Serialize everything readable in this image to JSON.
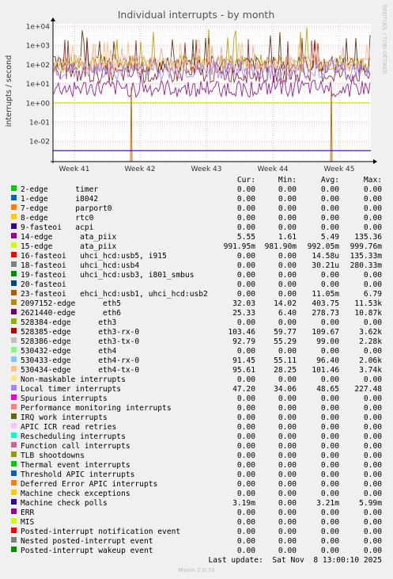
{
  "chart_data": {
    "type": "line",
    "title": "Individual interrupts - by month",
    "ylabel": "interrupts / second",
    "y_scale": "log",
    "ylim": [
      0.003,
      20000
    ],
    "yticks": [
      "1e+04",
      "1e+03",
      "1e+02",
      "1e+01",
      "1e+00",
      "1e-01",
      "1e-02"
    ],
    "xticks": [
      "Week 41",
      "Week 42",
      "Week 43",
      "Week 44",
      "Week 45"
    ],
    "watermark": "RRDTOOL / TOBI OETIKER",
    "grid": true,
    "series_levels": [
      {
        "name": "2097152-edge eth5",
        "color": "#b39b00",
        "base": 130,
        "spikes": [
          3000,
          9000
        ]
      },
      {
        "name": "2621440-edge eth6",
        "color": "#4c2a0e",
        "base": 100,
        "spikes": [
          2500,
          6500
        ]
      },
      {
        "name": "528385-edge eth3-rx-0",
        "color": "#8a1c1c",
        "base": 30,
        "spikes": [
          2000,
          2800
        ]
      },
      {
        "name": "530432-edge eth4",
        "color": "#f1a3a0",
        "base": 110,
        "spikes": [
          1200
        ]
      },
      {
        "name": "530434-edge eth4-tx-0",
        "color": "#ffc080",
        "base": 100,
        "spikes": [
          1800
        ]
      },
      {
        "name": "Local timer interrupts",
        "color": "#a080ff",
        "base": 45,
        "spikes": [
          200
        ]
      },
      {
        "name": "14-edge ata_piix",
        "color": "#8a0e8a",
        "base": 5.5,
        "spikes": [
          30
        ]
      },
      {
        "name": "15-edge ata_piix",
        "color": "#ccdd00",
        "base": 0.99,
        "spikes": []
      },
      {
        "name": "23-fasteoi ehci_hcd:usb1, uhci_hcd:usb2",
        "color": "#b86e10",
        "base": 0,
        "spikes": [
          6.79
        ]
      }
    ]
  },
  "legend": {
    "headers": {
      "cur": "Cur:",
      "min": "Min:",
      "avg": "Avg:",
      "max": "Max:"
    },
    "rows": [
      {
        "name": "2-edge      timer",
        "color": "#00cc00",
        "cur": "0.00",
        "min": "0.00",
        "avg": "0.00",
        "max": "0.00"
      },
      {
        "name": "1-edge      i8042",
        "color": "#0066b3",
        "cur": "0.00",
        "min": "0.00",
        "avg": "0.00",
        "max": "0.00"
      },
      {
        "name": "7-edge      parport0",
        "color": "#ff8000",
        "cur": "0.00",
        "min": "0.00",
        "avg": "0.00",
        "max": "0.00"
      },
      {
        "name": "8-edge      rtc0",
        "color": "#ffcc00",
        "cur": "0.00",
        "min": "0.00",
        "avg": "0.00",
        "max": "0.00"
      },
      {
        "name": "9-fasteoi   acpi",
        "color": "#330099",
        "cur": "0.00",
        "min": "0.00",
        "avg": "0.00",
        "max": "0.00"
      },
      {
        "name": "14-edge      ata_piix",
        "color": "#990099",
        "cur": "5.55",
        "min": "1.61",
        "avg": "5.49",
        "max": "135.36"
      },
      {
        "name": "15-edge      ata_piix",
        "color": "#ccff00",
        "cur": "991.95m",
        "min": "981.90m",
        "avg": "992.05m",
        "max": "999.76m"
      },
      {
        "name": "16-fasteoi   uhci_hcd:usb5, i915",
        "color": "#ff0000",
        "cur": "0.00",
        "min": "0.00",
        "avg": "14.58u",
        "max": "135.33m"
      },
      {
        "name": "18-fasteoi   uhci_hcd:usb4",
        "color": "#808080",
        "cur": "0.00",
        "min": "0.00",
        "avg": "30.21u",
        "max": "280.33m"
      },
      {
        "name": "19-fasteoi   uhci_hcd:usb3, i801_smbus",
        "color": "#008f00",
        "cur": "0.00",
        "min": "0.00",
        "avg": "0.00",
        "max": "0.00"
      },
      {
        "name": "20-fasteoi",
        "color": "#00487d",
        "cur": "0.00",
        "min": "0.00",
        "avg": "0.00",
        "max": "0.00"
      },
      {
        "name": "23-fasteoi   ehci_hcd:usb1, uhci_hcd:usb2",
        "color": "#b35a00",
        "cur": "0.00",
        "min": "0.00",
        "avg": "11.05m",
        "max": "6.79"
      },
      {
        "name": "2097152-edge      eth5",
        "color": "#b38f00",
        "cur": "32.03",
        "min": "14.02",
        "avg": "403.75",
        "max": "11.53k"
      },
      {
        "name": "2621440-edge      eth6",
        "color": "#6b006b",
        "cur": "25.33",
        "min": "6.40",
        "avg": "278.73",
        "max": "10.87k"
      },
      {
        "name": "528384-edge      eth3",
        "color": "#8fb300",
        "cur": "0.00",
        "min": "0.00",
        "avg": "0.00",
        "max": "0.00"
      },
      {
        "name": "528385-edge      eth3-rx-0",
        "color": "#b30000",
        "cur": "103.46",
        "min": "59.77",
        "avg": "109.67",
        "max": "3.62k"
      },
      {
        "name": "528386-edge      eth3-tx-0",
        "color": "#bebebe",
        "cur": "92.79",
        "min": "55.29",
        "avg": "99.00",
        "max": "2.28k"
      },
      {
        "name": "530432-edge      eth4",
        "color": "#80ff80",
        "cur": "0.00",
        "min": "0.00",
        "avg": "0.00",
        "max": "0.00"
      },
      {
        "name": "530433-edge      eth4-rx-0",
        "color": "#80c9ff",
        "cur": "91.45",
        "min": "55.11",
        "avg": "96.40",
        "max": "2.06k"
      },
      {
        "name": "530434-edge      eth4-tx-0",
        "color": "#ffc080",
        "cur": "95.61",
        "min": "28.25",
        "avg": "101.46",
        "max": "3.74k"
      },
      {
        "name": "Non-maskable interrupts",
        "color": "#ffe680",
        "cur": "0.00",
        "min": "0.00",
        "avg": "0.00",
        "max": "0.00"
      },
      {
        "name": "Local timer interrupts",
        "color": "#aa80ff",
        "cur": "47.20",
        "min": "34.06",
        "avg": "48.65",
        "max": "227.48"
      },
      {
        "name": "Spurious interrupts",
        "color": "#ee00cc",
        "cur": "0.00",
        "min": "0.00",
        "avg": "0.00",
        "max": "0.00"
      },
      {
        "name": "Performance monitoring interrupts",
        "color": "#ff8080",
        "cur": "0.00",
        "min": "0.00",
        "avg": "0.00",
        "max": "0.00"
      },
      {
        "name": "IRQ work interrupts",
        "color": "#666600",
        "cur": "0.00",
        "min": "0.00",
        "avg": "0.00",
        "max": "0.00"
      },
      {
        "name": "APIC ICR read retries",
        "color": "#ffbfff",
        "cur": "0.00",
        "min": "0.00",
        "avg": "0.00",
        "max": "0.00"
      },
      {
        "name": "Rescheduling interrupts",
        "color": "#00ffcc",
        "cur": "0.00",
        "min": "0.00",
        "avg": "0.00",
        "max": "0.00"
      },
      {
        "name": "Function call interrupts",
        "color": "#cc6699",
        "cur": "0.00",
        "min": "0.00",
        "avg": "0.00",
        "max": "0.00"
      },
      {
        "name": "TLB shootdowns",
        "color": "#999900",
        "cur": "0.00",
        "min": "0.00",
        "avg": "0.00",
        "max": "0.00"
      },
      {
        "name": "Thermal event interrupts",
        "color": "#00cc00",
        "cur": "0.00",
        "min": "0.00",
        "avg": "0.00",
        "max": "0.00"
      },
      {
        "name": "Threshold APIC interrupts",
        "color": "#0066b3",
        "cur": "0.00",
        "min": "0.00",
        "avg": "0.00",
        "max": "0.00"
      },
      {
        "name": "Deferred Error APIC interrupts",
        "color": "#ff8000",
        "cur": "0.00",
        "min": "0.00",
        "avg": "0.00",
        "max": "0.00"
      },
      {
        "name": "Machine check exceptions",
        "color": "#ffcc00",
        "cur": "0.00",
        "min": "0.00",
        "avg": "0.00",
        "max": "0.00"
      },
      {
        "name": "Machine check polls",
        "color": "#330099",
        "cur": "3.19m",
        "min": "0.00",
        "avg": "3.21m",
        "max": "5.99m"
      },
      {
        "name": "ERR",
        "color": "#990099",
        "cur": "0.00",
        "min": "0.00",
        "avg": "0.00",
        "max": "0.00"
      },
      {
        "name": "MIS",
        "color": "#ccff00",
        "cur": "0.00",
        "min": "0.00",
        "avg": "0.00",
        "max": "0.00"
      },
      {
        "name": "Posted-interrupt notification event",
        "color": "#ff0000",
        "cur": "0.00",
        "min": "0.00",
        "avg": "0.00",
        "max": "0.00"
      },
      {
        "name": "Nested posted-interrupt event",
        "color": "#808080",
        "cur": "0.00",
        "min": "0.00",
        "avg": "0.00",
        "max": "0.00"
      },
      {
        "name": "Posted-interrupt wakeup event",
        "color": "#008f00",
        "cur": "0.00",
        "min": "0.00",
        "avg": "0.00",
        "max": "0.00"
      }
    ]
  },
  "footer": {
    "last_update": "Last update:  Sat Nov  8 13:00:10 2025",
    "munin_version": "Munin 2.0.73"
  }
}
